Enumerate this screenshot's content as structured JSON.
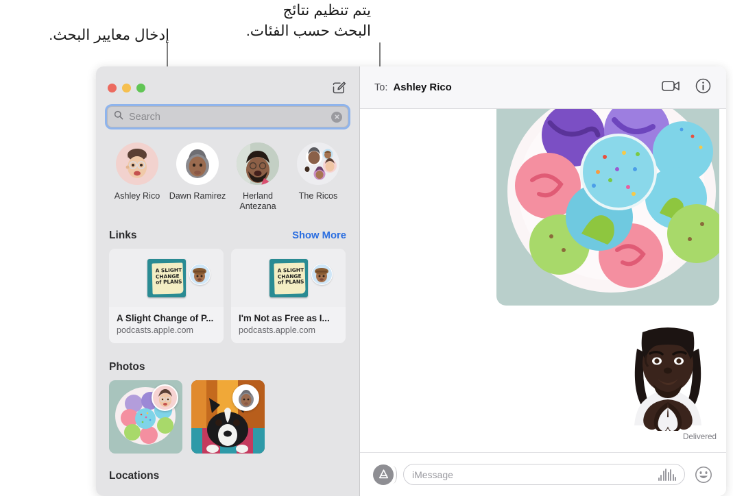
{
  "annotations": {
    "categories_note": "يتم تنظيم نتائج\nالبحث حسب الفئات.",
    "criteria_note": "إدخال معايير البحث."
  },
  "window": {
    "traffic_lights": [
      "close-button",
      "minimize-button",
      "zoom-button"
    ],
    "compose_icon": "compose-icon"
  },
  "sidebar": {
    "search": {
      "icon": "search-icon",
      "placeholder": "Search",
      "value": "",
      "clear_icon": "clear-icon",
      "focus_ring_color": "#8fb4ec"
    },
    "contacts": [
      {
        "name": "Ashley Rico",
        "avatar": "memoji-ashley"
      },
      {
        "name": "Dawn Ramirez",
        "avatar": "memoji-dawn"
      },
      {
        "name": "Herland Antezana",
        "avatar": "photo-herland"
      },
      {
        "name": "The Ricos",
        "avatar": "group-avatar-ricos"
      }
    ],
    "links": {
      "title": "Links",
      "action": "Show More",
      "action_color": "#2b6ee0",
      "items": [
        {
          "title": "A Slight Change of P...",
          "host": "podcasts.apple.com",
          "artwork_text": "A SLIGHT\nCHANGE of\nPLANS",
          "badge": "memoji-sender"
        },
        {
          "title": "I'm Not as Free as I...",
          "host": "podcasts.apple.com",
          "artwork_text": "A SLIGHT\nCHANGE of\nPLANS",
          "badge": "memoji-sender"
        }
      ]
    },
    "photos": {
      "title": "Photos",
      "items": [
        {
          "alt": "macarons-plate-photo",
          "badge": "memoji-ashley"
        },
        {
          "alt": "boston-terrier-photo",
          "badge": "memoji-dawn"
        }
      ]
    },
    "locations": {
      "title": "Locations"
    }
  },
  "conversation": {
    "to_label": "To:",
    "recipient": "Ashley Rico",
    "facetime_icon": "video-camera-icon",
    "details_icon": "info-icon",
    "messages": [
      {
        "type": "photo",
        "alt": "macarons-on-plate-image"
      },
      {
        "type": "sticker",
        "alt": "memoji-heart-hands-sticker",
        "status": "Delivered"
      }
    ],
    "composer": {
      "apps_icon": "app-store-icon",
      "placeholder": "iMessage",
      "value": "",
      "audio_icon": "audio-waveform-icon",
      "emoji_icon": "emoji-smiley-icon"
    }
  }
}
